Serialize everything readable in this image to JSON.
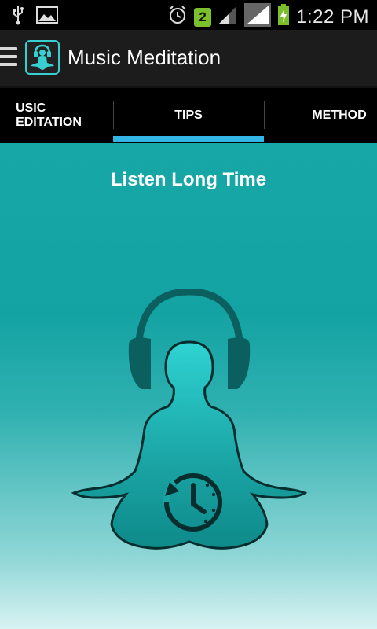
{
  "status_bar": {
    "time": "1:22 PM",
    "notification_count": "2",
    "icons": [
      "usb-icon",
      "image-icon",
      "alarm-icon",
      "notification-badge",
      "signal-icon",
      "signal-icon",
      "battery-charging-icon"
    ]
  },
  "action_bar": {
    "title": "Music Meditation",
    "icon": "meditation-headphones-icon"
  },
  "tabs": [
    {
      "label": "USIC\nEDITATION",
      "selected": false
    },
    {
      "label": "TIPS",
      "selected": true
    },
    {
      "label": "METHOD",
      "selected": false
    }
  ],
  "content": {
    "title": "Listen Long Time",
    "illustration": "meditating-person-with-headphones-clock-icon"
  },
  "colors": {
    "accent": "#33b5e5",
    "teal": "#17a7a7",
    "dark_teal": "#0d6464"
  }
}
